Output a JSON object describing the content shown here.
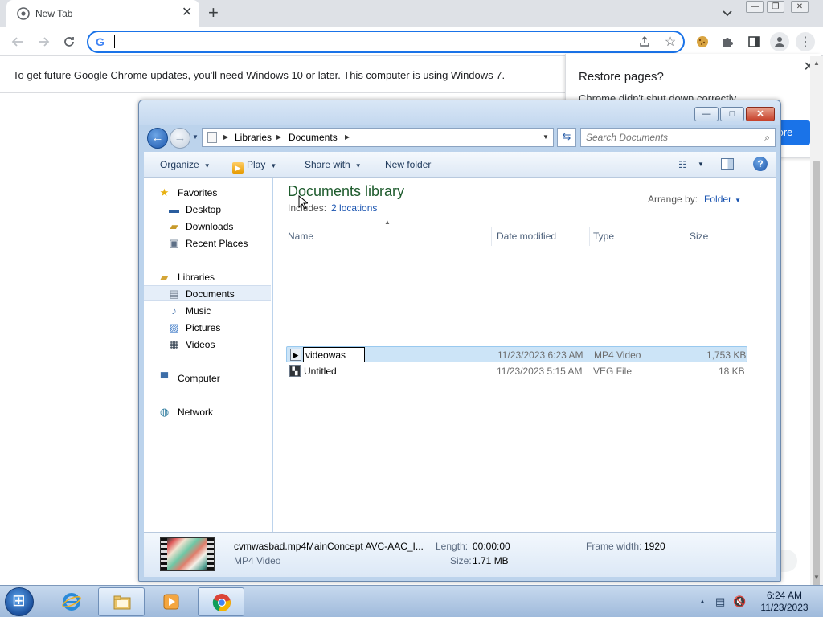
{
  "chrome": {
    "tab_title": "New Tab",
    "new_tab_glyph": "+",
    "close_glyph": "✕",
    "omnibox": {
      "value": "",
      "placeholder": ""
    },
    "infobar_text": "To get future Google Chrome updates, you'll need Windows 10 or later. This computer is using Windows 7.",
    "restore": {
      "title": "Restore pages?",
      "text": "Chrome didn't shut down correctly.",
      "button_fragment": "tore"
    }
  },
  "explorer": {
    "breadcrumbs": [
      "Libraries",
      "Documents"
    ],
    "search_placeholder": "Search Documents",
    "commands": {
      "organize": "Organize",
      "play": "Play",
      "share_with": "Share with",
      "new_folder": "New folder"
    },
    "nav": {
      "favorites_header": "Favorites",
      "favorites": [
        "Desktop",
        "Downloads",
        "Recent Places"
      ],
      "libraries_header": "Libraries",
      "libraries": [
        "Documents",
        "Music",
        "Pictures",
        "Videos"
      ],
      "computer": "Computer",
      "network": "Network",
      "selected": "Documents"
    },
    "library": {
      "title": "Documents library",
      "includes_label": "Includes:",
      "locations_link": "2 locations",
      "arrange_label": "Arrange by:",
      "arrange_value": "Folder"
    },
    "columns": {
      "name": "Name",
      "date": "Date modified",
      "type": "Type",
      "size": "Size"
    },
    "files": [
      {
        "name": "videowas",
        "date": "11/23/2023 6:23 AM",
        "type": "MP4 Video",
        "size": "1,753 KB",
        "renaming": true
      },
      {
        "name": "Untitled",
        "date": "11/23/2023 5:15 AM",
        "type": "VEG File",
        "size": "18 KB",
        "renaming": false
      }
    ],
    "details": {
      "filename": "cvmwasbad.mp4MainConcept AVC-AAC_I...",
      "filetype": "MP4 Video",
      "length_label": "Length:",
      "length_value": "00:00:00",
      "size_label": "Size:",
      "size_value": "1.71 MB",
      "frame_width_label": "Frame width:",
      "frame_width_value": "1920"
    }
  },
  "taskbar": {
    "time": "6:24 AM",
    "date": "11/23/2023"
  },
  "colors": {
    "chrome_accent": "#1a73e8",
    "explorer_frame": "#bcd3ec",
    "library_title": "#1e5b2d",
    "link_blue": "#1a54b0",
    "selection": "#cce4f7"
  }
}
